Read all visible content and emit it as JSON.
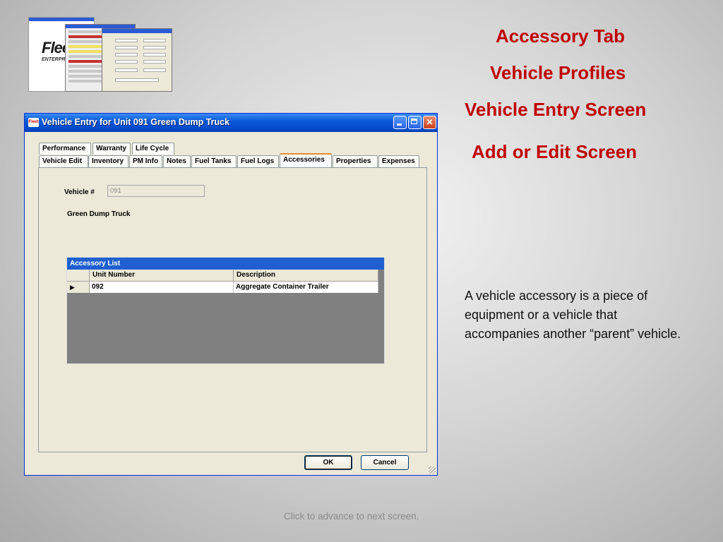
{
  "slide": {
    "headings": [
      "Accessory Tab",
      "Vehicle Profiles",
      "Vehicle Entry Screen",
      "Add or Edit Screen"
    ],
    "description": "A vehicle accessory is a piece of equipment or a vehicle that accompanies another “parent” vehicle.",
    "footer": "Click to advance to next screen.",
    "accent_color": "#c00000",
    "thumbnail_logo": "Flee",
    "thumbnail_logo_sub": "ENTERPRIS"
  },
  "window": {
    "title": "Vehicle Entry for Unit 091 Green Dump Truck",
    "tabs_row1": [
      "Performance",
      "Warranty",
      "Life Cycle"
    ],
    "tabs_row2": [
      "Vehicle Edit",
      "Inventory",
      "PM Info",
      "Notes",
      "Fuel Tanks",
      "Fuel Logs",
      "Accessories",
      "Properties",
      "Expenses"
    ],
    "active_tab": "Accessories",
    "vehicle_label": "Vehicle #",
    "vehicle_value": "091",
    "vehicle_name": "Green Dump Truck",
    "grid": {
      "title": "Accessory List",
      "columns": [
        "Unit Number",
        "Description"
      ],
      "rows": [
        {
          "unit": "092",
          "description": "Aggregate Container Trailer"
        }
      ],
      "row_marker": "▶"
    },
    "ok_label": "OK",
    "cancel_label": "Cancel"
  }
}
